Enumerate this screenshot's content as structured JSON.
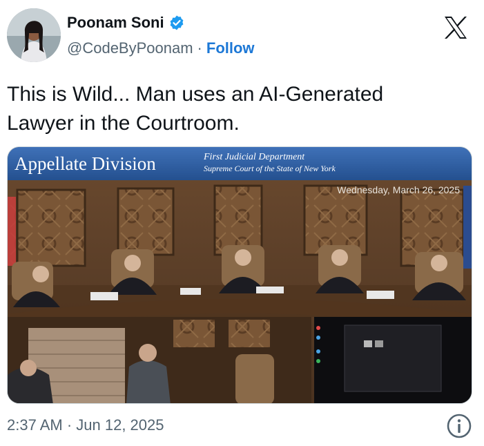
{
  "author": {
    "name": "Poonam Soni",
    "handle": "@CodeByPoonam",
    "separator": "·",
    "follow_label": "Follow"
  },
  "tweet": {
    "text": "This is Wild... Man uses an AI-Generated\nLawyer in the Courtroom.",
    "timestamp": "2:37 AM · Jun 12, 2025"
  },
  "media": {
    "banner_title": "Appellate Division",
    "banner_subtitle_1": "First Judicial Department",
    "banner_subtitle_2": "Supreme Court of the State of New York",
    "date_overlay": "Wednesday, March 26, 2025"
  },
  "colors": {
    "verified": "#1d9bf0",
    "follow": "#1d78d6",
    "banner": "#2f5fa8"
  },
  "icons": [
    "verified-badge-icon",
    "x-logo-icon",
    "info-icon"
  ]
}
